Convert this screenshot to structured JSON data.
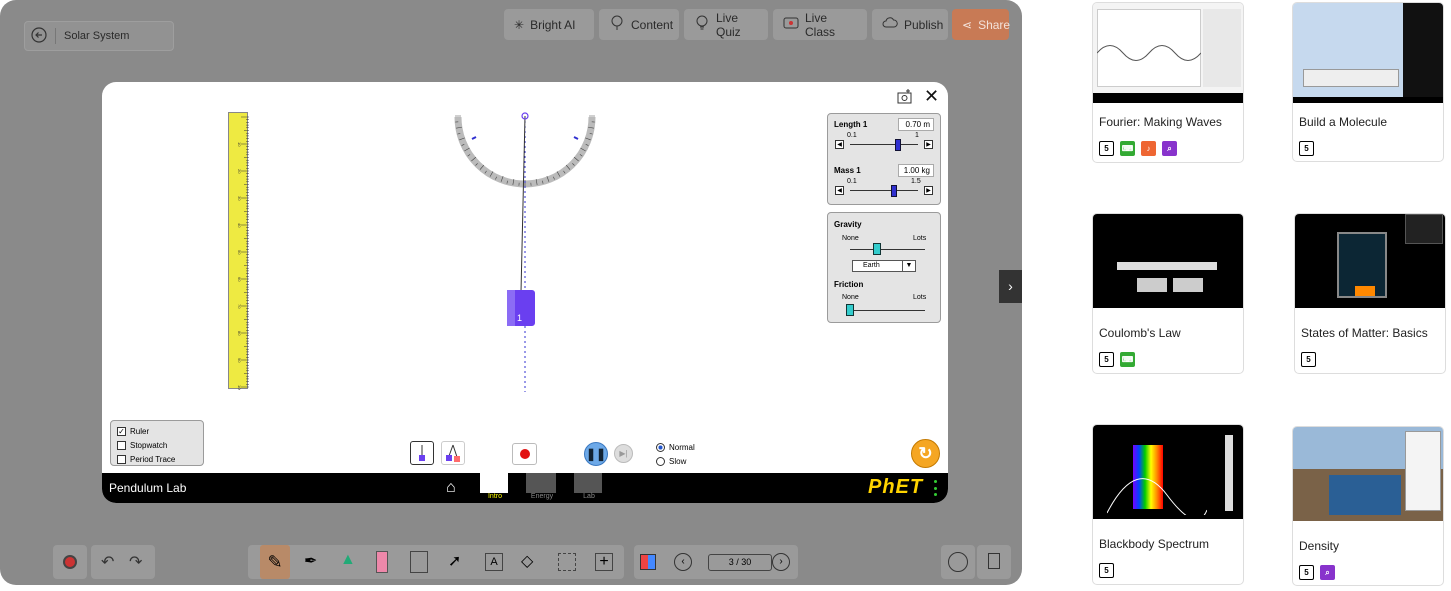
{
  "header": {
    "title": "Solar System",
    "buttons": [
      {
        "label": "Bright AI",
        "icon": "sparkle-icon"
      },
      {
        "label": "Content",
        "icon": "tree-icon"
      },
      {
        "label": "Live Quiz",
        "icon": "bulb-icon"
      },
      {
        "label": "Live Class",
        "icon": "record-icon"
      },
      {
        "label": "Publish",
        "icon": "cloud-upload-icon"
      },
      {
        "label": "Share",
        "icon": "share-icon"
      }
    ]
  },
  "sim": {
    "name": "Pendulum Lab",
    "length": {
      "label": "Length 1",
      "value": "0.70 m",
      "min": "0.1",
      "max": "1",
      "fraction": 0.7
    },
    "mass": {
      "label": "Mass 1",
      "value": "1.00 kg",
      "min": "0.1",
      "max": "1.5",
      "fraction": 0.64
    },
    "gravity": {
      "label": "Gravity",
      "min": "None",
      "max": "Lots",
      "selected": "Earth"
    },
    "friction": {
      "label": "Friction",
      "min": "None",
      "max": "Lots"
    },
    "options": [
      {
        "label": "Ruler",
        "checked": true
      },
      {
        "label": "Stopwatch",
        "checked": false
      },
      {
        "label": "Period Trace",
        "checked": false
      }
    ],
    "speed": [
      {
        "label": "Normal",
        "selected": true
      },
      {
        "label": "Slow",
        "selected": false
      }
    ],
    "pendulum_number": "1",
    "tabs": [
      {
        "label": "Intro",
        "active": true
      },
      {
        "label": "Energy",
        "active": false
      },
      {
        "label": "Lab",
        "active": false
      }
    ],
    "logo": "PhET",
    "ruler_labels": [
      "10",
      "20",
      "30",
      "40",
      "50",
      "60",
      "70",
      "80",
      "90",
      "100",
      "cm"
    ]
  },
  "footer": {
    "page": "3 / 30"
  },
  "cards": [
    {
      "title": "Fourier: Making Waves",
      "icons": [
        "html5-icon",
        "keyboard-icon",
        "sound-icon",
        "zoom-icon"
      ]
    },
    {
      "title": "Build a Molecule",
      "icons": [
        "html5-icon"
      ]
    },
    {
      "title": "Coulomb's Law",
      "icons": [
        "html5-icon",
        "keyboard-icon"
      ]
    },
    {
      "title": "States of Matter: Basics",
      "icons": [
        "html5-icon"
      ]
    },
    {
      "title": "Blackbody Spectrum",
      "icons": [
        "html5-icon"
      ]
    },
    {
      "title": "Density",
      "icons": [
        "html5-icon",
        "zoom-icon"
      ]
    }
  ],
  "colors": {
    "accent": "#e06c3a",
    "phet_yellow": "#ffd400",
    "pendulum": "#6a3ff0"
  }
}
